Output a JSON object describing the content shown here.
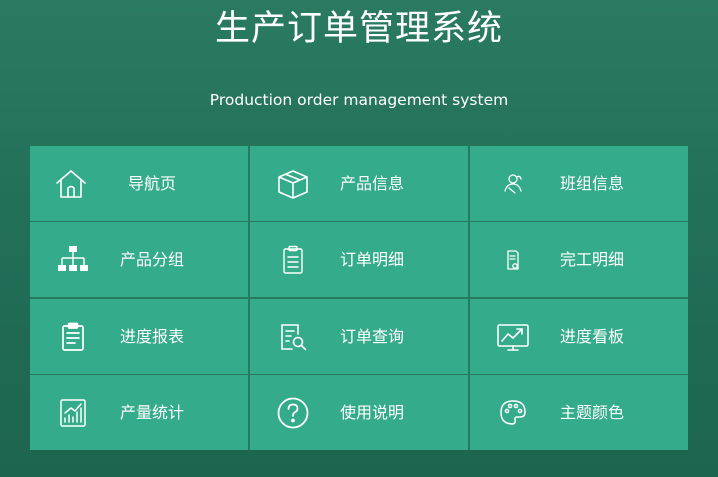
{
  "header": {
    "title": "生产订单管理系统",
    "subtitle": "Production order management system"
  },
  "menu": [
    {
      "label": "导航页",
      "icon": "home-icon"
    },
    {
      "label": "产品信息",
      "icon": "box-icon"
    },
    {
      "label": "班组信息",
      "icon": "team-icon"
    },
    {
      "label": "产品分组",
      "icon": "hierarchy-icon"
    },
    {
      "label": "订单明细",
      "icon": "clipboard-icon"
    },
    {
      "label": "完工明细",
      "icon": "document-icon"
    },
    {
      "label": "进度报表",
      "icon": "report-icon"
    },
    {
      "label": "订单查询",
      "icon": "search-document-icon"
    },
    {
      "label": "进度看板",
      "icon": "dashboard-chart-icon"
    },
    {
      "label": "产量统计",
      "icon": "bar-chart-icon"
    },
    {
      "label": "使用说明",
      "icon": "question-icon"
    },
    {
      "label": "主题颜色",
      "icon": "palette-icon"
    }
  ],
  "colors": {
    "background": "#216d56",
    "tile": "#34ab8a",
    "text": "#ffffff"
  }
}
